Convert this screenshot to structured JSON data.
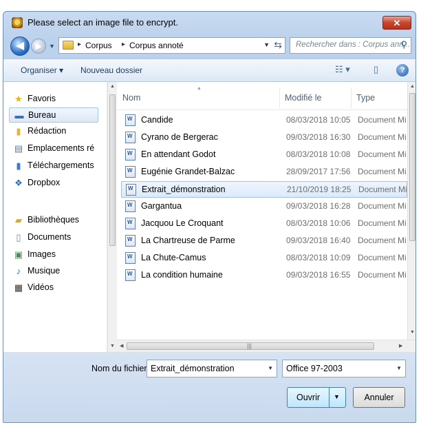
{
  "window": {
    "title": "Please select an image file to encrypt.",
    "close_label": "✕"
  },
  "address": {
    "breadcrumbs": [
      "Corpus",
      "Corpus annoté"
    ],
    "search_placeholder": "Rechercher dans : Corpus ann..."
  },
  "toolbar": {
    "organize_label": "Organiser ▾",
    "new_folder_label": "Nouveau dossier",
    "help_label": "?"
  },
  "sidebar": {
    "items": [
      {
        "label": "Favoris",
        "icon": "star-icon"
      },
      {
        "label": "Bureau",
        "icon": "desktop-icon"
      },
      {
        "label": "Rédaction",
        "icon": "folder-icon"
      },
      {
        "label": "Emplacements ré",
        "icon": "recent-places-icon"
      },
      {
        "label": "Téléchargements",
        "icon": "downloads-icon"
      },
      {
        "label": "Dropbox",
        "icon": "dropbox-icon"
      },
      {
        "label": "Bibliothèques",
        "icon": "libraries-icon"
      },
      {
        "label": "Documents",
        "icon": "documents-icon"
      },
      {
        "label": "Images",
        "icon": "images-icon"
      },
      {
        "label": "Musique",
        "icon": "music-icon"
      },
      {
        "label": "Vidéos",
        "icon": "videos-icon"
      }
    ]
  },
  "files": {
    "columns": [
      "Nom",
      "Modifié le",
      "Type"
    ],
    "rows": [
      {
        "name": "Candide",
        "date": "08/03/2018 10:05",
        "type": "Document Mi"
      },
      {
        "name": "Cyrano de Bergerac",
        "date": "09/03/2018 16:30",
        "type": "Document Mi"
      },
      {
        "name": "En attendant Godot",
        "date": "08/03/2018 10:08",
        "type": "Document Mi"
      },
      {
        "name": "Eugénie Grandet-Balzac",
        "date": "28/09/2017 17:56",
        "type": "Document Mi"
      },
      {
        "name": "Extrait_démonstration",
        "date": "21/10/2019 18:25",
        "type": "Document Mi"
      },
      {
        "name": "Gargantua",
        "date": "09/03/2018 16:28",
        "type": "Document Mi"
      },
      {
        "name": "Jacquou Le Croquant",
        "date": "08/03/2018 10:06",
        "type": "Document Mi"
      },
      {
        "name": "La Chartreuse de Parme",
        "date": "09/03/2018 16:40",
        "type": "Document Mi"
      },
      {
        "name": "La Chute-Camus",
        "date": "08/03/2018 10:09",
        "type": "Document Mi"
      },
      {
        "name": "La condition humaine",
        "date": "09/03/2018 16:55",
        "type": "Document Mi"
      }
    ],
    "selected_index": 4
  },
  "footer": {
    "filename_label": "Nom du fichier :",
    "filename_value": "Extrait_démonstration",
    "filetype_value": "Office 97-2003",
    "open_label": "Ouvrir",
    "cancel_label": "Annuler"
  }
}
